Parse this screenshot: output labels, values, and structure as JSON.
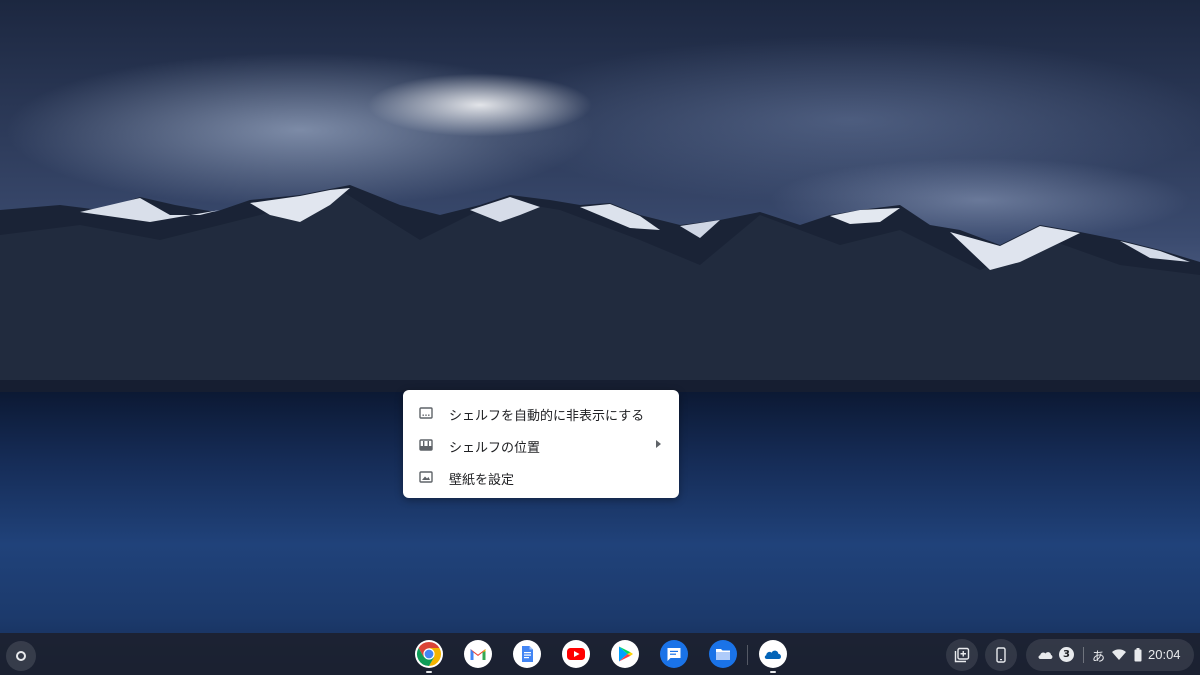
{
  "context_menu": {
    "items": [
      {
        "label": "シェルフを自動的に非表示にする",
        "icon": "autohide-icon",
        "has_submenu": false
      },
      {
        "label": "シェルフの位置",
        "icon": "shelf-position-icon",
        "has_submenu": true
      },
      {
        "label": "壁紙を設定",
        "icon": "wallpaper-icon",
        "has_submenu": false
      }
    ]
  },
  "shelf": {
    "apps": [
      {
        "name": "Chrome",
        "icon": "chrome-icon",
        "running": true
      },
      {
        "name": "Gmail",
        "icon": "gmail-icon",
        "running": false
      },
      {
        "name": "Docs",
        "icon": "docs-icon",
        "running": false
      },
      {
        "name": "YouTube",
        "icon": "youtube-icon",
        "running": false
      },
      {
        "name": "Play Store",
        "icon": "play-store-icon",
        "running": false
      },
      {
        "name": "Messages",
        "icon": "messages-icon",
        "running": false
      },
      {
        "name": "Files",
        "icon": "files-icon",
        "running": false
      },
      {
        "name": "OneDrive",
        "icon": "onedrive-icon",
        "running": true
      }
    ]
  },
  "status_tray": {
    "notification_count": "3",
    "ime_indicator": "あ",
    "clock": "20:04"
  },
  "colors": {
    "menu_bg": "#ffffff",
    "menu_text": "#202124",
    "shelf_bg": "#1c202c",
    "tray_text": "#e8eaed"
  }
}
